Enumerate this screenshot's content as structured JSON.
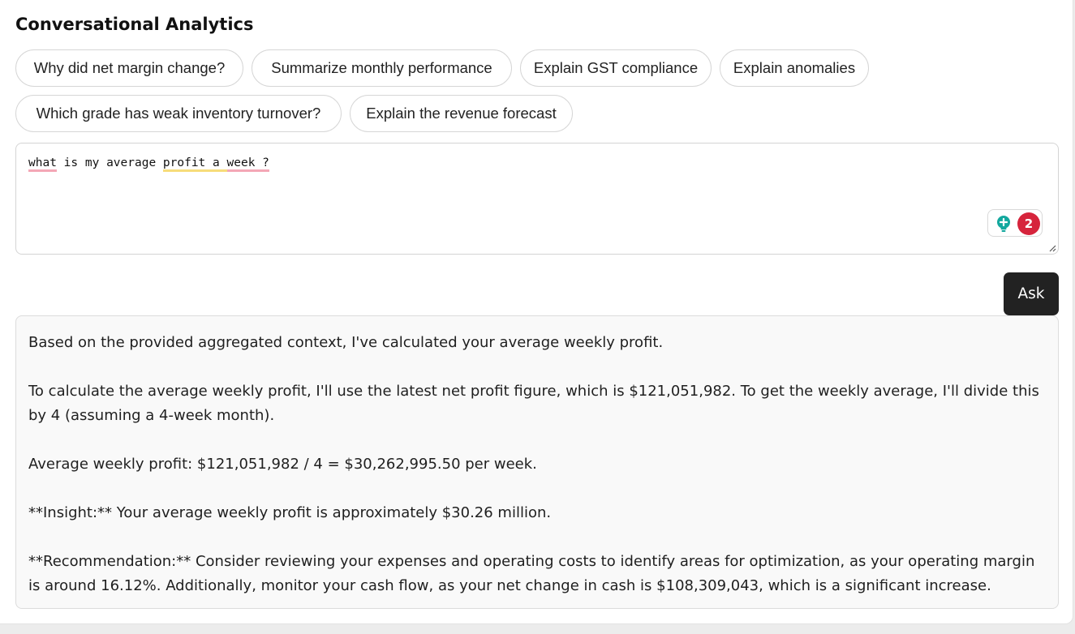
{
  "header": {
    "title": "Conversational Analytics"
  },
  "suggestions": [
    "Why did net margin change?",
    "Summarize monthly performance",
    "Explain GST compliance",
    "Explain anomalies",
    "Which grade has weak inventory turnover?",
    "Explain the revenue forecast"
  ],
  "prompt": {
    "words": [
      "what",
      "is",
      "my",
      "average",
      "profit",
      "a",
      "week",
      "?"
    ],
    "grammar_count": "2"
  },
  "ask_label": "Ask",
  "answer": {
    "paragraphs": [
      "Based on the provided aggregated context, I've calculated your average weekly profit.",
      "To calculate the average weekly profit, I'll use the latest net profit figure, which is $121,051,982. To get the weekly average, I'll divide this by 4 (assuming a 4-week month).",
      "Average weekly profit: $121,051,982 / 4 = $30,262,995.50 per week.",
      "**Insight:** Your average weekly profit is approximately $30.26 million.",
      "**Recommendation:** Consider reviewing your expenses and operating costs to identify areas for optimization, as your operating margin is around 16.12%. Additionally, monitor your cash flow, as your net change in cash is $108,309,043, which is a significant increase."
    ]
  },
  "colors": {
    "accent_button": "#222222",
    "spell_underline": "#f4a7b6",
    "grammar_underline": "#f7dc7a",
    "badge_red": "#d6243c",
    "bulb_teal": "#13a89e"
  }
}
